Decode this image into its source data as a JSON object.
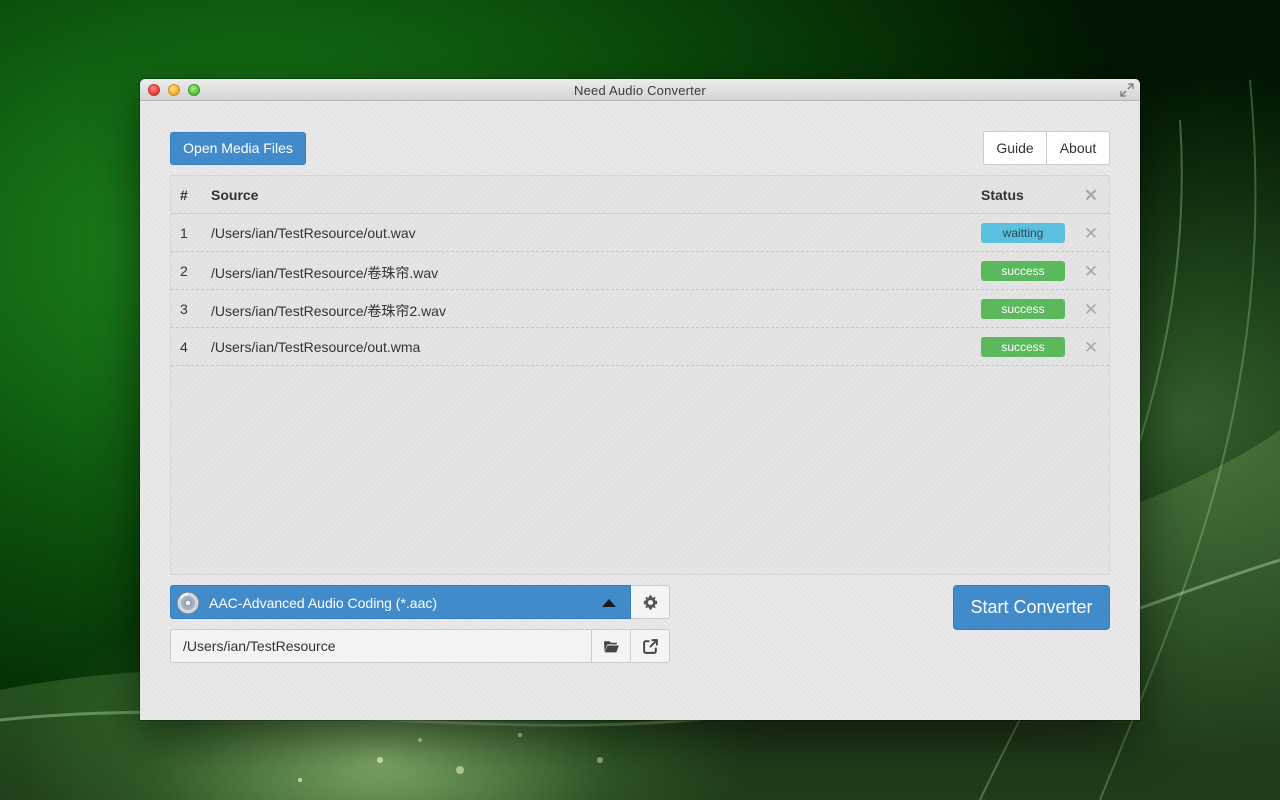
{
  "window": {
    "title": "Need Audio Converter"
  },
  "toolbar": {
    "open_label": "Open Media Files",
    "guide_label": "Guide",
    "about_label": "About"
  },
  "table": {
    "columns": {
      "num": "#",
      "source": "Source",
      "status": "Status"
    },
    "rows": [
      {
        "num": "1",
        "source": "/Users/ian/TestResource/out.wav",
        "status": "waitting"
      },
      {
        "num": "2",
        "source": "/Users/ian/TestResource/卷珠帘.wav",
        "status": "success"
      },
      {
        "num": "3",
        "source": "/Users/ian/TestResource/卷珠帘2.wav",
        "status": "success"
      },
      {
        "num": "4",
        "source": "/Users/ian/TestResource/out.wma",
        "status": "success"
      }
    ]
  },
  "format": {
    "selected": "AAC-Advanced Audio Coding (*.aac)",
    "icon": "audio-cd-icon"
  },
  "output": {
    "path": "/Users/ian/TestResource"
  },
  "actions": {
    "start_label": "Start Converter"
  },
  "colors": {
    "primary": "#428bca",
    "success": "#5cb85c",
    "info": "#5bc0de"
  }
}
